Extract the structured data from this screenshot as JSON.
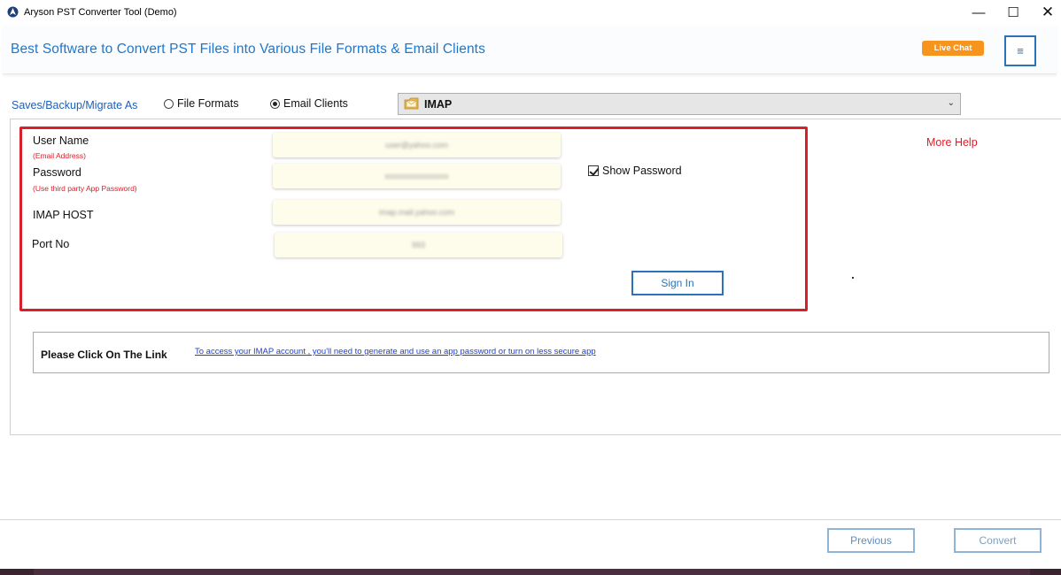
{
  "window": {
    "title": "Aryson PST Converter Tool (Demo)",
    "min_glyph": "—",
    "max_glyph": "☐",
    "close_glyph": "✕"
  },
  "banner": {
    "title": "Best Software to Convert PST Files into Various File Formats & Email Clients",
    "live_chat": "Live Chat",
    "menu_glyph": "≡"
  },
  "saveas": {
    "label": "Saves/Backup/Migrate As",
    "options": [
      {
        "label": "File Formats",
        "checked": false
      },
      {
        "label": "Email Clients",
        "checked": true
      }
    ],
    "selected_client": "IMAP",
    "dropdown_icon": "chevron-down-icon"
  },
  "form": {
    "username_label": "User Name",
    "username_hint": "(Email Address)",
    "username_value": "user@yahoo.com",
    "password_label": "Password",
    "password_hint": "(Use third party App Password)",
    "password_value": "xxxxxxxxxxxxxxxx",
    "host_label": "IMAP HOST",
    "host_value": "imap.mail.yahoo.com",
    "port_label": "Port No",
    "port_value": "993",
    "show_password_label": "Show Password",
    "show_password_checked": true,
    "sign_in": "Sign In",
    "more_help": "More Help"
  },
  "link_panel": {
    "label": "Please Click On The Link",
    "link_text": "To access your IMAP account , you'll need to generate and use an app password or turn on less secure app"
  },
  "footer": {
    "previous": "Previous",
    "convert": "Convert"
  },
  "colors": {
    "accent": "#1f77c9",
    "live_chat": "#f7941d",
    "highlight_border": "#d9202a",
    "input_bg": "#fefcea"
  }
}
